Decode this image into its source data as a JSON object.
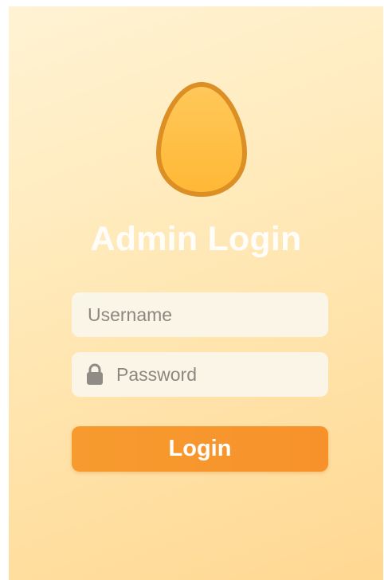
{
  "login": {
    "title": "Admin Login",
    "username": {
      "placeholder": "Username",
      "value": ""
    },
    "password": {
      "placeholder": "Password",
      "value": ""
    },
    "button_label": "Login"
  },
  "icons": {
    "logo": "egg-icon",
    "password_field": "lock-icon"
  },
  "colors": {
    "background_start": "#fff3d4",
    "background_end": "#ffd892",
    "egg_fill": "#ffbf45",
    "egg_stroke": "#dc8f24",
    "button": "#f79b2f",
    "field_background": "#faf6ec"
  }
}
